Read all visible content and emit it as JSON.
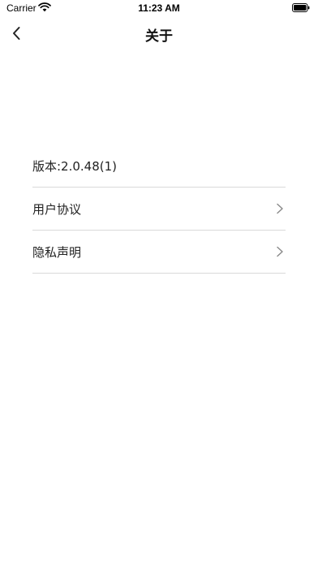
{
  "status_bar": {
    "carrier": "Carrier",
    "time": "11:23 AM"
  },
  "nav": {
    "title": "关于"
  },
  "about": {
    "version": "版本:2.0.48(1)",
    "items": [
      {
        "label": "用户协议"
      },
      {
        "label": "隐私声明"
      }
    ]
  }
}
